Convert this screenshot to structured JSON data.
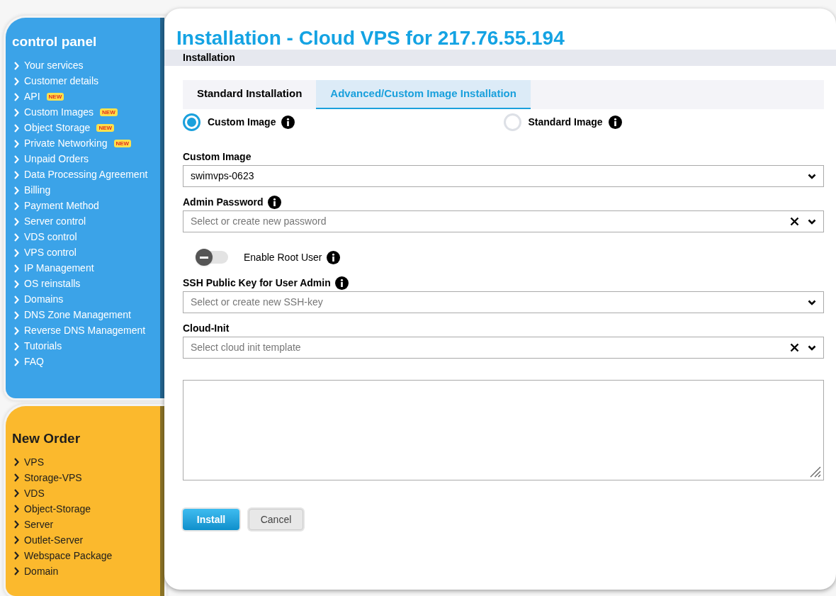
{
  "sidebar": {
    "control_panel": {
      "title": "control panel",
      "items": [
        {
          "label": "Your services"
        },
        {
          "label": "Customer details"
        },
        {
          "label": "API",
          "badge": "NEW"
        },
        {
          "label": "Custom Images",
          "badge": "NEW"
        },
        {
          "label": "Object Storage",
          "badge": "NEW"
        },
        {
          "label": "Private Networking",
          "badge": "NEW"
        },
        {
          "label": "Unpaid Orders"
        },
        {
          "label": "Data Processing Agreement"
        },
        {
          "label": "Billing"
        },
        {
          "label": "Payment Method"
        },
        {
          "label": "Server control"
        },
        {
          "label": "VDS control"
        },
        {
          "label": "VPS control"
        },
        {
          "label": "IP Management"
        },
        {
          "label": "OS reinstalls"
        },
        {
          "label": "Domains"
        },
        {
          "label": "DNS Zone Management"
        },
        {
          "label": "Reverse DNS Management"
        },
        {
          "label": "Tutorials"
        },
        {
          "label": "FAQ"
        }
      ]
    },
    "new_order": {
      "title": "New Order",
      "items": [
        {
          "label": "VPS"
        },
        {
          "label": "Storage-VPS"
        },
        {
          "label": "VDS"
        },
        {
          "label": "Object-Storage"
        },
        {
          "label": "Server"
        },
        {
          "label": "Outlet-Server"
        },
        {
          "label": "Webspace Package"
        },
        {
          "label": "Domain"
        }
      ]
    }
  },
  "main": {
    "title": "Installation - Cloud VPS for 217.76.55.194",
    "section": "Installation",
    "tabs": [
      {
        "label": "Standard Installation",
        "selected": false
      },
      {
        "label": "Advanced/Custom Image Installation",
        "selected": true
      }
    ],
    "image_types": [
      {
        "label": "Custom Image",
        "selected": true
      },
      {
        "label": "Standard Image",
        "selected": false
      }
    ],
    "fields": [
      {
        "kind": "select",
        "label": "Custom Image",
        "info": false,
        "value": "swimvps-0623",
        "clearable": false
      },
      {
        "kind": "select",
        "label": "Admin Password",
        "info": true,
        "placeholder": "Select or create new password",
        "clearable": true
      },
      {
        "kind": "toggle",
        "label": "Enable Root User",
        "info": true,
        "on": false
      },
      {
        "kind": "select",
        "label": "SSH Public Key for User Admin",
        "info": true,
        "placeholder": "Select or create new SSH-key",
        "clearable": false
      },
      {
        "kind": "select",
        "label": "Cloud-Init",
        "info": false,
        "placeholder": "Select cloud init template",
        "clearable": true
      },
      {
        "kind": "textarea"
      }
    ],
    "buttons": [
      {
        "label": "Install",
        "kind": "primary"
      },
      {
        "label": "Cancel",
        "kind": "secondary"
      }
    ]
  }
}
